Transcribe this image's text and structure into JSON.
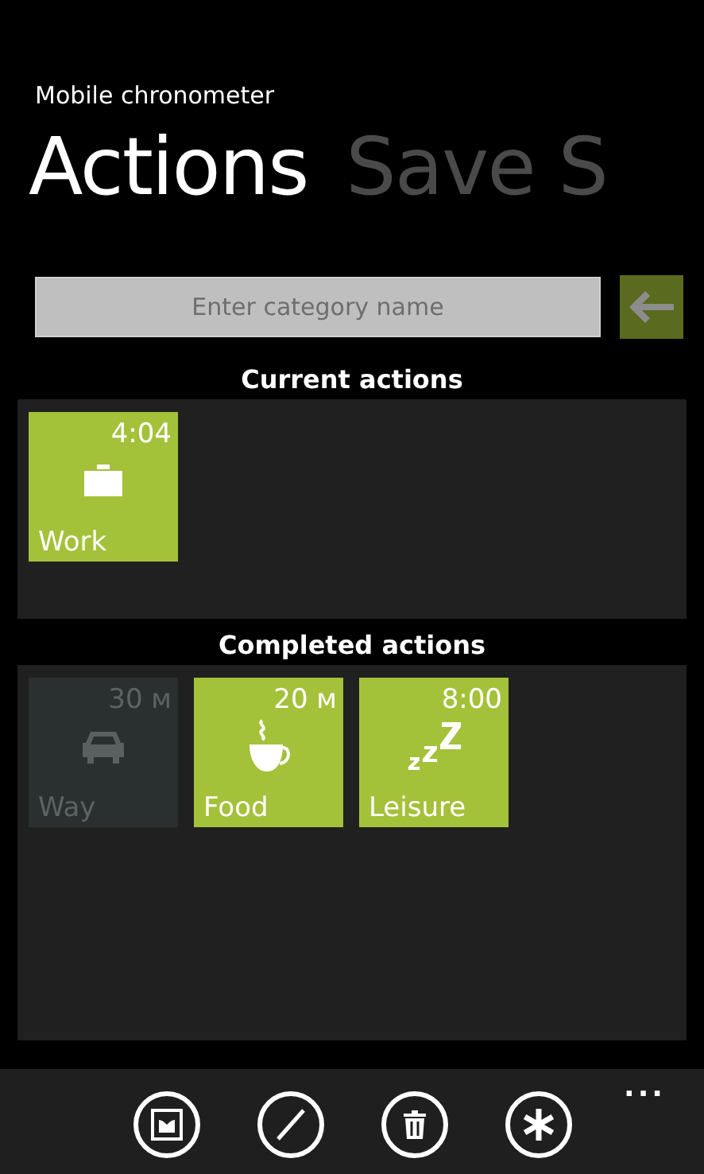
{
  "app_title": "Mobile chronometer",
  "pivot": [
    {
      "label": "Actions",
      "selected": true
    },
    {
      "label": "Save S",
      "selected": false
    }
  ],
  "search": {
    "placeholder": "Enter category name"
  },
  "current": {
    "title": "Current actions",
    "tiles": [
      {
        "kind": "briefcase",
        "name": "Work",
        "time": "4:04",
        "disabled": false
      }
    ]
  },
  "completed": {
    "title": "Completed actions",
    "tiles": [
      {
        "kind": "car",
        "name": "Way",
        "time": "30 м",
        "disabled": true
      },
      {
        "kind": "cup",
        "name": "Food",
        "time": "20 м",
        "disabled": false
      },
      {
        "kind": "sleep",
        "name": "Leisure",
        "time": "8:00",
        "disabled": false
      }
    ]
  },
  "app_bar": {
    "more": "..."
  }
}
